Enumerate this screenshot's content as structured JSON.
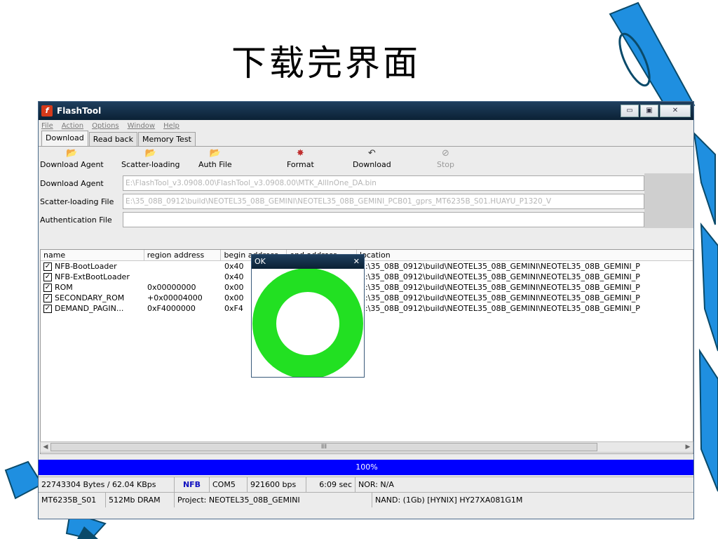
{
  "slide": {
    "title": "下载完界面"
  },
  "window": {
    "title": "FlashTool",
    "buttons": {
      "minimize": "▭",
      "maximize": "▣",
      "close": "✕"
    }
  },
  "menu": [
    "File",
    "Action",
    "Options",
    "Window",
    "Help"
  ],
  "tabs": [
    "Download",
    "Read back",
    "Memory Test"
  ],
  "toolbar": [
    {
      "label": "Download Agent",
      "icon": "open-folder-icon"
    },
    {
      "label": "Scatter-loading",
      "icon": "open-folder-icon"
    },
    {
      "label": "Auth File",
      "icon": "open-folder-icon"
    },
    {
      "label": "Format",
      "icon": "format-icon"
    },
    {
      "label": "Download",
      "icon": "download-icon"
    },
    {
      "label": "Stop",
      "icon": "stop-icon"
    }
  ],
  "fields": {
    "download_agent": {
      "label": "Download Agent",
      "value": "E:\\FlashTool_v3.0908.00\\FlashTool_v3.0908.00\\MTK_AllInOne_DA.bin"
    },
    "scatter": {
      "label": "Scatter-loading File",
      "value": "E:\\35_08B_0912\\build\\NEOTEL35_08B_GEMINI\\NEOTEL35_08B_GEMINI_PCB01_gprs_MT6235B_S01.HUAYU_P1320_V"
    },
    "auth": {
      "label": "Authentication File",
      "value": ""
    }
  },
  "list": {
    "columns": [
      "name",
      "region address",
      "begin address",
      "end address",
      "location"
    ],
    "rows": [
      {
        "name": "NFB-BootLoader",
        "region": "",
        "begin": "0x40",
        "location": "E:\\35_08B_0912\\build\\NEOTEL35_08B_GEMINI\\NEOTEL35_08B_GEMINI_P"
      },
      {
        "name": "NFB-ExtBootLoader",
        "region": "",
        "begin": "0x40",
        "location": "E:\\35_08B_0912\\build\\NEOTEL35_08B_GEMINI\\NEOTEL35_08B_GEMINI_P"
      },
      {
        "name": "ROM",
        "region": "0x00000000",
        "begin": "0x00",
        "location": "E:\\35_08B_0912\\build\\NEOTEL35_08B_GEMINI\\NEOTEL35_08B_GEMINI_P"
      },
      {
        "name": "SECONDARY_ROM",
        "region": "+0x00004000",
        "begin": "0x00",
        "location": "E:\\35_08B_0912\\build\\NEOTEL35_08B_GEMINI\\NEOTEL35_08B_GEMINI_P"
      },
      {
        "name": "DEMAND_PAGIN...",
        "region": "0xF4000000",
        "begin": "0xF4",
        "location": "E:\\35_08B_0912\\build\\NEOTEL35_08B_GEMINI\\NEOTEL35_08B_GEMINI_P"
      }
    ],
    "scroll_thumb_label": "III"
  },
  "progress": {
    "label": "100%",
    "fraction": 1.0,
    "color": "#0000ff"
  },
  "status1": [
    "22743304 Bytes / 62.04 KBps",
    "NFB",
    "COM5",
    "921600 bps",
    "6:09 sec",
    "NOR: N/A"
  ],
  "status2": [
    "MT6235B_S01",
    "512Mb DRAM",
    "Project: NEOTEL35_08B_GEMINI",
    "NAND: (1Gb) [HYNIX] HY27XA081G1M"
  ],
  "ok_dialog": {
    "title": "OK",
    "close": "✕",
    "ring_color": "#22e022"
  },
  "colors": {
    "pencil": "#1f8fe0",
    "pencil_dark": "#0a4a6a",
    "titlebar": "#0b2135"
  }
}
